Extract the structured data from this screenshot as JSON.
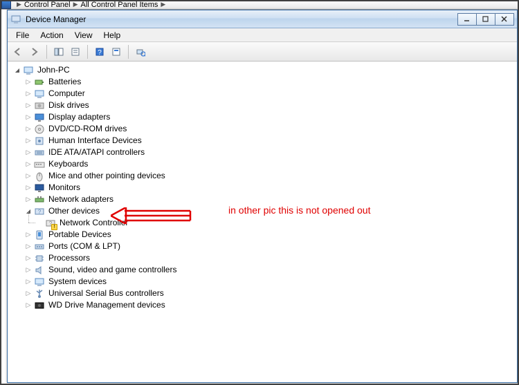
{
  "breadcrumb": {
    "items": [
      "Control Panel",
      "All Control Panel Items"
    ]
  },
  "window": {
    "title": "Device Manager"
  },
  "menubar": {
    "items": [
      "File",
      "Action",
      "View",
      "Help"
    ]
  },
  "tree": {
    "root": {
      "label": "John-PC",
      "icon": "computer-icon",
      "expanded": true
    },
    "nodes": [
      {
        "label": "Batteries",
        "icon": "battery-icon",
        "expanded": false
      },
      {
        "label": "Computer",
        "icon": "computer-icon",
        "expanded": false
      },
      {
        "label": "Disk drives",
        "icon": "disk-icon",
        "expanded": false
      },
      {
        "label": "Display adapters",
        "icon": "display-icon",
        "expanded": false
      },
      {
        "label": "DVD/CD-ROM drives",
        "icon": "dvd-icon",
        "expanded": false
      },
      {
        "label": "Human Interface Devices",
        "icon": "hid-icon",
        "expanded": false
      },
      {
        "label": "IDE ATA/ATAPI controllers",
        "icon": "ide-icon",
        "expanded": false
      },
      {
        "label": "Keyboards",
        "icon": "keyboard-icon",
        "expanded": false
      },
      {
        "label": "Mice and other pointing devices",
        "icon": "mouse-icon",
        "expanded": false
      },
      {
        "label": "Monitors",
        "icon": "monitor-icon",
        "expanded": false
      },
      {
        "label": "Network adapters",
        "icon": "network-icon",
        "expanded": false
      },
      {
        "label": "Other devices",
        "icon": "other-icon",
        "expanded": true,
        "children": [
          {
            "label": "Network Controller",
            "icon": "unknown-device-icon",
            "warn": true
          }
        ]
      },
      {
        "label": "Portable Devices",
        "icon": "portable-icon",
        "expanded": false
      },
      {
        "label": "Ports (COM & LPT)",
        "icon": "port-icon",
        "expanded": false
      },
      {
        "label": "Processors",
        "icon": "cpu-icon",
        "expanded": false
      },
      {
        "label": "Sound, video and game controllers",
        "icon": "sound-icon",
        "expanded": false
      },
      {
        "label": "System devices",
        "icon": "system-icon",
        "expanded": false
      },
      {
        "label": "Universal Serial Bus controllers",
        "icon": "usb-icon",
        "expanded": false
      },
      {
        "label": "WD Drive Management devices",
        "icon": "wd-icon",
        "expanded": false
      }
    ]
  },
  "annotation": {
    "text": "in other pic this is not opened out"
  },
  "colors": {
    "annotation": "#e00000",
    "titlebar_start": "#e7eff8",
    "titlebar_end": "#bcd4ec"
  }
}
